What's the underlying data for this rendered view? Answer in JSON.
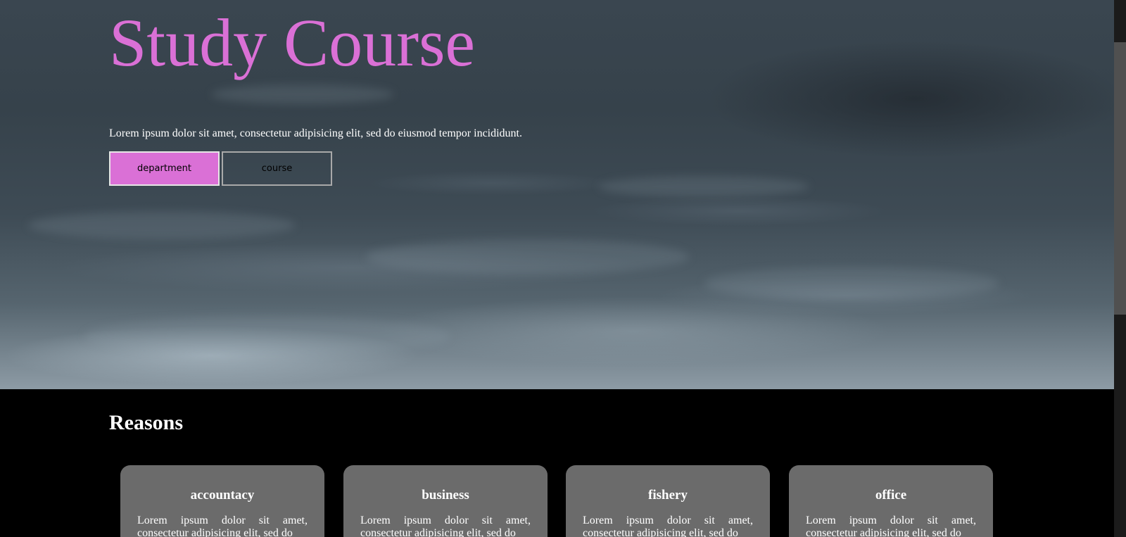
{
  "hero": {
    "title": "Study Course",
    "description": "Lorem ipsum dolor sit amet, consectetur adipisicing elit, sed do eiusmod tempor incididunt.",
    "buttons": {
      "primary_label": "department",
      "secondary_label": "course"
    }
  },
  "reasons": {
    "heading": "Reasons",
    "cards": [
      {
        "title": "accountacy",
        "text": "Lorem ipsum dolor sit amet, consectetur adipisicing elit, sed do"
      },
      {
        "title": "business",
        "text": "Lorem ipsum dolor sit amet, consectetur adipisicing elit, sed do"
      },
      {
        "title": "fishery",
        "text": "Lorem ipsum dolor sit amet, consectetur adipisicing elit, sed do"
      },
      {
        "title": "office",
        "text": "Lorem ipsum dolor sit amet, consectetur adipisicing elit, sed do"
      }
    ]
  },
  "colors": {
    "accent": "#da70d6",
    "card_bg": "#6b6b6b",
    "section_bg": "#000000"
  }
}
